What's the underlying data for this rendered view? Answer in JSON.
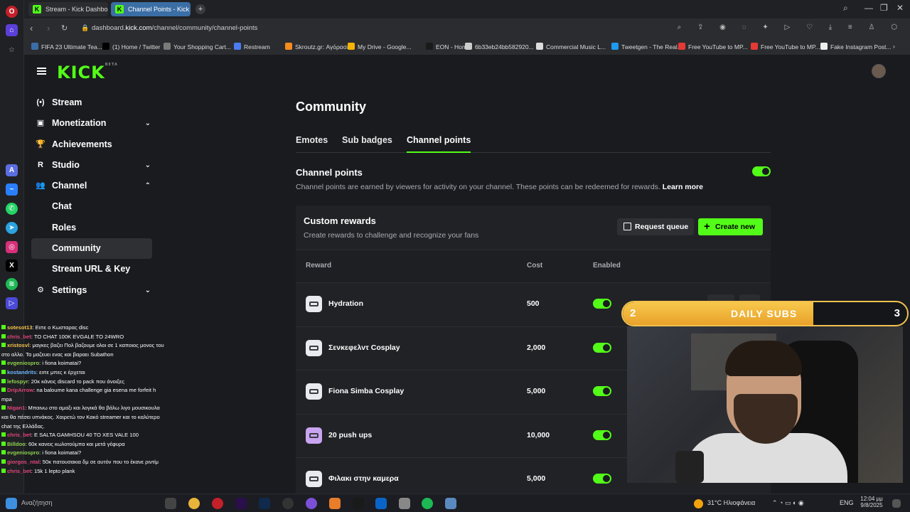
{
  "browser": {
    "tabs": [
      {
        "label": "Stream - Kick Dashboard"
      },
      {
        "label": "Channel Points - Kick Das"
      }
    ],
    "url_host": "dashboard.",
    "url_domain": "kick.com",
    "url_path": "/channel/community/channel-points",
    "bookmarks": [
      {
        "label": "FIFA 23 Ultimate Tea...",
        "color": "#3b6ea8"
      },
      {
        "label": "(1) Home / Twitter",
        "color": "#000000"
      },
      {
        "label": "Your Shopping Cart...",
        "color": "#7a7a7a"
      },
      {
        "label": "Restream",
        "color": "#4c7cf3"
      },
      {
        "label": "Skroutz.gr: Αγόρασε...",
        "color": "#f68b1f"
      },
      {
        "label": "My Drive - Google...",
        "color": "#f4b400"
      },
      {
        "label": "EON - Home",
        "color": "#1a1a1a"
      },
      {
        "label": "6b33eb24bb582920...",
        "color": "#cccccc"
      },
      {
        "label": "Commercial Music L...",
        "color": "#dddddd"
      },
      {
        "label": "Tweetgen - The Real...",
        "color": "#1d9bf0"
      },
      {
        "label": "Free YouTube to MP...",
        "color": "#e53935"
      },
      {
        "label": "Free YouTube to MP...",
        "color": "#e53935"
      },
      {
        "label": "Fake Instagram Post...",
        "color": "#eeeeee"
      }
    ]
  },
  "kick": {
    "logo": "KICK",
    "logo_beta": "BETA"
  },
  "sidebar": {
    "items": [
      {
        "label": "Stream",
        "icon": "(•)"
      },
      {
        "label": "Monetization",
        "icon": "▣",
        "chevron": "⌄"
      },
      {
        "label": "Achievements",
        "icon": "🏆"
      },
      {
        "label": "Studio",
        "icon": "R",
        "chevron": "⌄"
      },
      {
        "label": "Channel",
        "icon": "👥",
        "chevron": "⌃"
      },
      {
        "label": "Chat"
      },
      {
        "label": "Roles"
      },
      {
        "label": "Community"
      },
      {
        "label": "Stream URL & Key"
      },
      {
        "label": "Settings",
        "icon": "⚙",
        "chevron": "⌄"
      }
    ]
  },
  "main": {
    "title": "Community",
    "tabs": [
      "Emotes",
      "Sub badges",
      "Channel points"
    ],
    "section_title": "Channel points",
    "section_desc": "Channel points are earned by viewers for activity on your channel. These points can be redeemed for rewards.",
    "learn_more": "Learn more",
    "rewards": {
      "title": "Custom rewards",
      "desc": "Create rewards to challenge and recognize your fans",
      "request_queue": "Request queue",
      "create_new": "Create new",
      "columns": [
        "Reward",
        "Cost",
        "Enabled"
      ],
      "rows": [
        {
          "name": "Hydration",
          "cost": "500"
        },
        {
          "name": "Σενκεφελντ Cosplay",
          "cost": "2,000"
        },
        {
          "name": "Fiona Simba Cosplay",
          "cost": "5,000"
        },
        {
          "name": "20 push ups",
          "cost": "10,000"
        },
        {
          "name": "Φιλακι στην καμερα",
          "cost": "5,000"
        }
      ]
    }
  },
  "overlay": {
    "left": "2",
    "title": "DAILY SUBS",
    "right": "3",
    "progress": 0.67
  },
  "chat": [
    {
      "user": "sotesot13",
      "color": "#f2c14e",
      "msg": ": Ειπε ο Κωσταρας disc"
    },
    {
      "user": "chris_bet",
      "color": "#e0457b",
      "msg": ": TO CHAT 100K EVGALE TO 24WRO"
    },
    {
      "user": "xristosvl",
      "color": "#f2c14e",
      "msg": ": μαγκες βαζει Πολ βαζουμε ολοι σε 1 καποιος μονος του στο αλλο. Τα μαζευει ενας και βαραει Subathon"
    },
    {
      "user": "evgeniospro",
      "color": "#8fd14f",
      "msg": ": i fiona koimatai?"
    },
    {
      "user": "kostandrits",
      "color": "#6fb7ff",
      "msg": ": ειπε μπες κ έρχεται"
    },
    {
      "user": "lefospyr",
      "color": "#8fd14f",
      "msg": ": 20κ κάνεις discard το pack που άνοιξες"
    },
    {
      "user": "DripArrow",
      "color": "#e0457b",
      "msg": ": na baloume kana challenge gia esena me forfeit h mpa"
    },
    {
      "user": "Nigan1",
      "color": "#e0457b",
      "msg": ": Μπαινω στο αμαξι και λογικά θα βάλω λιγο μουσικουλα και θα πέσει υπνάκος. Χαιρετώ τον Κακό streamer και το καλύτερο chat της Ελλάδας."
    },
    {
      "user": "chris_bet",
      "color": "#e0457b",
      "msg": ": E SALTA GAMHSOU 40 TO XES VALE 100"
    },
    {
      "user": "Billdoo",
      "color": "#8fd14f",
      "msg": ": 60κ κανεις κωλοτούμπα και μετά γέφυρα"
    },
    {
      "user": "evgeniospro",
      "color": "#8fd14f",
      "msg": ": i fiona koimatai?"
    },
    {
      "user": "giorgos_ntal",
      "color": "#e0457b",
      "msg": ": 50κ πατουσακια δμ σε αυτόν που το έκανε ριντίμ"
    },
    {
      "user": "chris_bet",
      "color": "#e0457b",
      "msg": ": 15k 1 lepto plank"
    }
  ],
  "taskbar": {
    "search": "Αναζήτηση",
    "weather": "31°C Ηλιοφάνεια",
    "lang": "ENG",
    "time": "12:04 μμ",
    "date": "9/8/2025"
  }
}
